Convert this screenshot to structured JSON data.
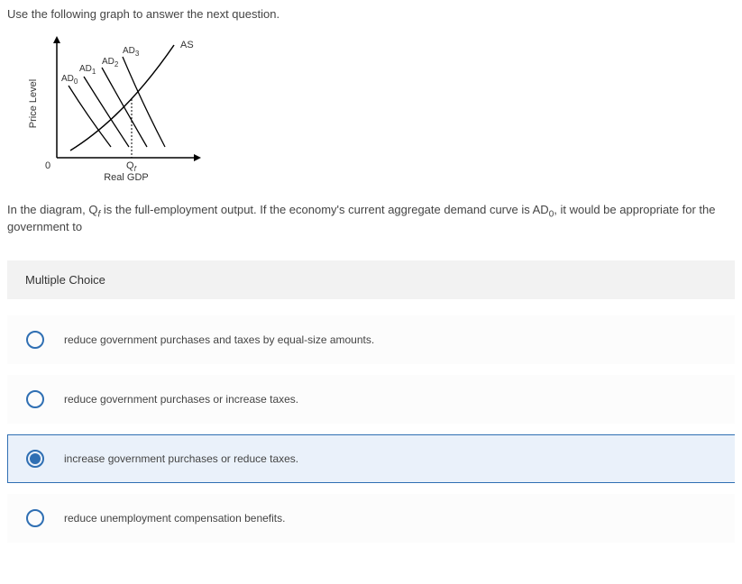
{
  "instruction": "Use the following graph to answer the next question.",
  "graph": {
    "y_axis_label": "Price Level",
    "x_axis_label": "Real GDP",
    "origin_label": "0",
    "curves": {
      "as": "AS",
      "ad0": "AD",
      "ad0_sub": "0",
      "ad1": "AD",
      "ad1_sub": "1",
      "ad2": "AD",
      "ad2_sub": "2",
      "ad3": "AD",
      "ad3_sub": "3"
    },
    "qf_label": "Q",
    "qf_sub": "f"
  },
  "question": {
    "pre": "In the diagram, ",
    "qf": "Q",
    "qf_sub": "f",
    "mid1": " is the full-employment output. If the economy's current aggregate demand curve is AD",
    "ad_sub": "0",
    "post": ", it would be appropriate for the government to"
  },
  "mc_label": "Multiple Choice",
  "options": [
    "reduce government purchases and taxes by equal-size amounts.",
    "reduce government purchases or increase taxes.",
    "increase government purchases or reduce taxes.",
    "reduce unemployment compensation benefits."
  ],
  "selected_index": 2
}
